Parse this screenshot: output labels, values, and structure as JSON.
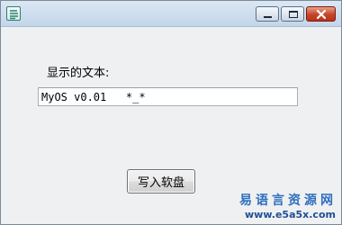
{
  "window": {
    "icon": "app-logo-icon",
    "controls": {
      "minimize": "minimize-icon",
      "maximize": "maximize-icon",
      "close": "close-icon"
    }
  },
  "form": {
    "label": "显示的文本:",
    "input_value": "MyOS v0.01   *_*",
    "write_button_label": "写入软盘"
  },
  "watermark": {
    "site_name": "易语言资源网",
    "url": "www.e5a5x.com"
  },
  "colors": {
    "titlebar": "#c8d9ec",
    "close_button": "#c7452a",
    "watermark_blue": "#2f6fbf"
  }
}
